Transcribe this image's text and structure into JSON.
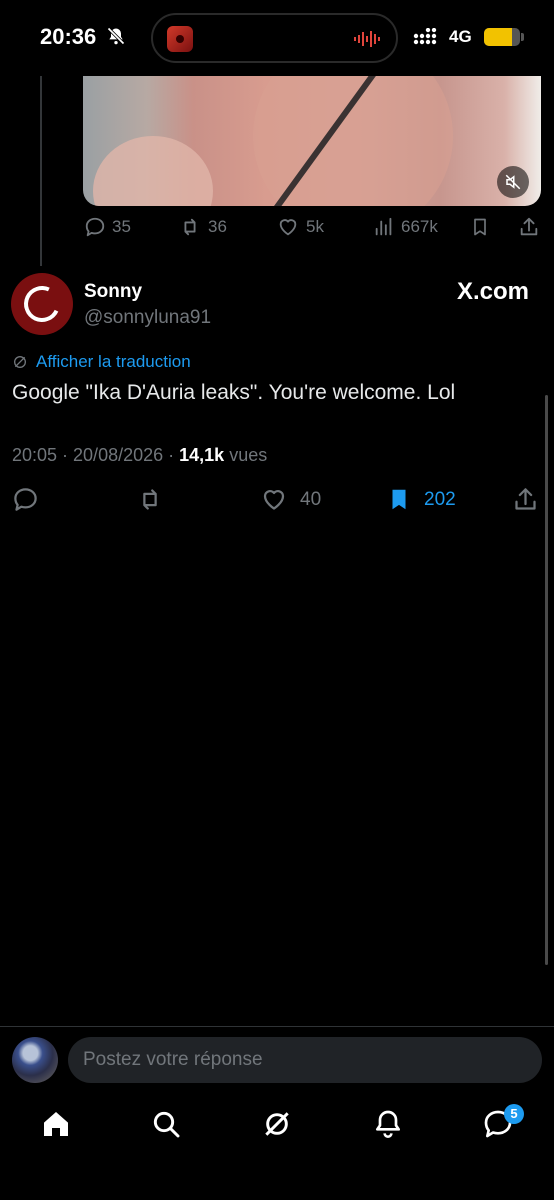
{
  "status_bar": {
    "time": "20:36",
    "network": "4G",
    "battery_level": 0.78,
    "colors": {
      "battery": "#f2c200",
      "wave": "#e0453c"
    }
  },
  "prev_tweet": {
    "actions": {
      "replies": "35",
      "reposts": "36",
      "likes": "5k",
      "views": "667k"
    }
  },
  "tweet": {
    "display_name": "Sonny",
    "handle": "@sonnyluna91",
    "source": "X.com",
    "translate_label": "Afficher la traduction",
    "text": "Google \"Ika D'Auria leaks\". You're welcome. Lol",
    "timestamp": "20:05 · 20/08/2026 ·",
    "views_count": "14,1k",
    "views_label": "vues",
    "actions": {
      "likes": "40",
      "bookmarks": "202"
    }
  },
  "reply": {
    "placeholder": "Postez votre réponse"
  },
  "nav": {
    "messages_badge": "5",
    "items": [
      "home-icon",
      "search-icon",
      "grok-icon",
      "bell-icon",
      "messages-icon"
    ]
  },
  "colors": {
    "accent": "#1d9bf0",
    "muted": "#71767b",
    "text": "#e7e9ea",
    "background": "#000000"
  }
}
